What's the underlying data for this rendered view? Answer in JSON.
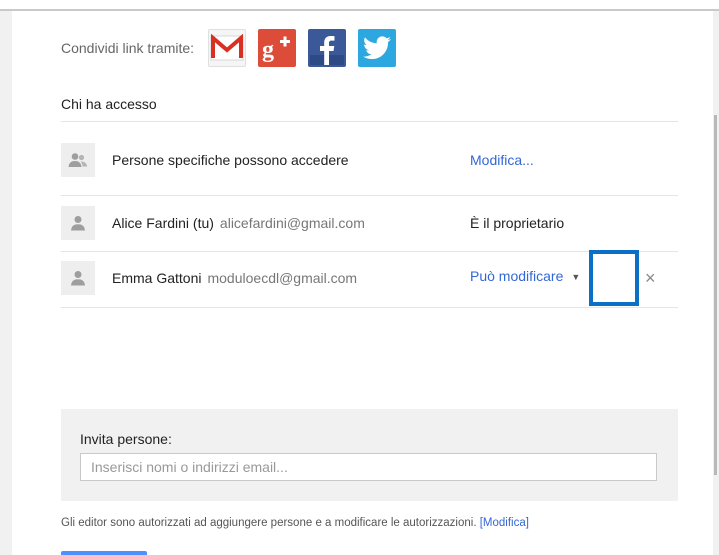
{
  "share": {
    "label": "Condividi link tramite:",
    "services": [
      {
        "name": "gmail",
        "icon": "gmail-icon",
        "color": "#ffffff"
      },
      {
        "name": "google-plus",
        "icon": "google-plus-icon",
        "color": "#dd4b39"
      },
      {
        "name": "facebook",
        "icon": "facebook-icon",
        "color": "#3b5998"
      },
      {
        "name": "twitter",
        "icon": "twitter-icon",
        "color": "#2ca7e0"
      }
    ]
  },
  "access": {
    "title": "Chi ha accesso",
    "visibility": {
      "label": "Persone specifiche possono accedere",
      "action": "Modifica..."
    },
    "people": [
      {
        "name": "Alice Fardini (tu)",
        "email": "alicefardini@gmail.com",
        "role": "È il proprietario"
      },
      {
        "name": "Emma Gattoni",
        "email": "moduloecdl@gmail.com",
        "role": "Può modificare",
        "remove": "×"
      }
    ]
  },
  "invite": {
    "label": "Invita persone:",
    "placeholder": "Inserisci nomi o indirizzi email...",
    "value": ""
  },
  "footer": {
    "note": "Gli editor sono autorizzati ad aggiungere persone e a modificare le autorizzazioni.",
    "link": "[Modifica]"
  },
  "colors": {
    "link": "#3367d6",
    "highlight": "#0b6fc6"
  }
}
